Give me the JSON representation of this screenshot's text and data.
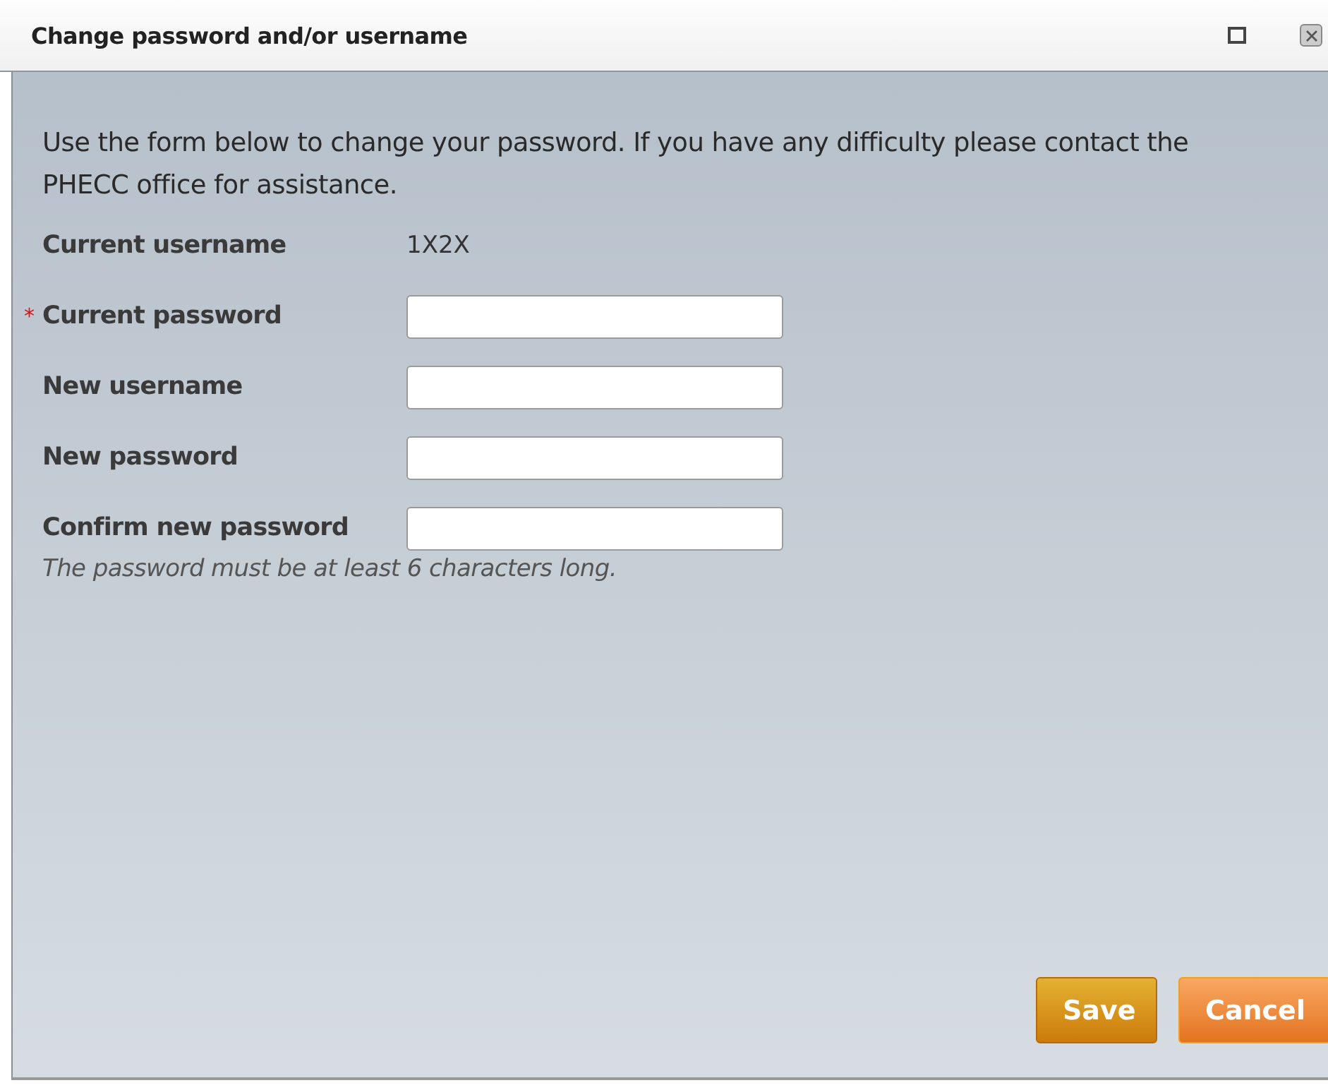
{
  "window": {
    "title": "Change password and/or username",
    "controls": [
      {
        "kind": "maximize"
      },
      {
        "kind": "close"
      }
    ]
  },
  "intro": "Use the form below to change your password. If you have any difficulty please contact the PHECC office for assistance.",
  "fields": [
    {
      "kind": "text",
      "label": "Current username",
      "value": "1X2X",
      "required": false
    },
    {
      "kind": "input",
      "label": "Current password",
      "required": true
    },
    {
      "kind": "input",
      "label": "New username",
      "required": false
    },
    {
      "kind": "input",
      "label": "New password",
      "required": false
    },
    {
      "kind": "input",
      "label": "Confirm new password",
      "required": false
    }
  ],
  "required_mark": "*",
  "hint": "The password must be at least 6 characters long.",
  "buttons": [
    {
      "label": "Save",
      "kind": "primary"
    },
    {
      "label": "Cancel",
      "kind": "secondary"
    }
  ]
}
